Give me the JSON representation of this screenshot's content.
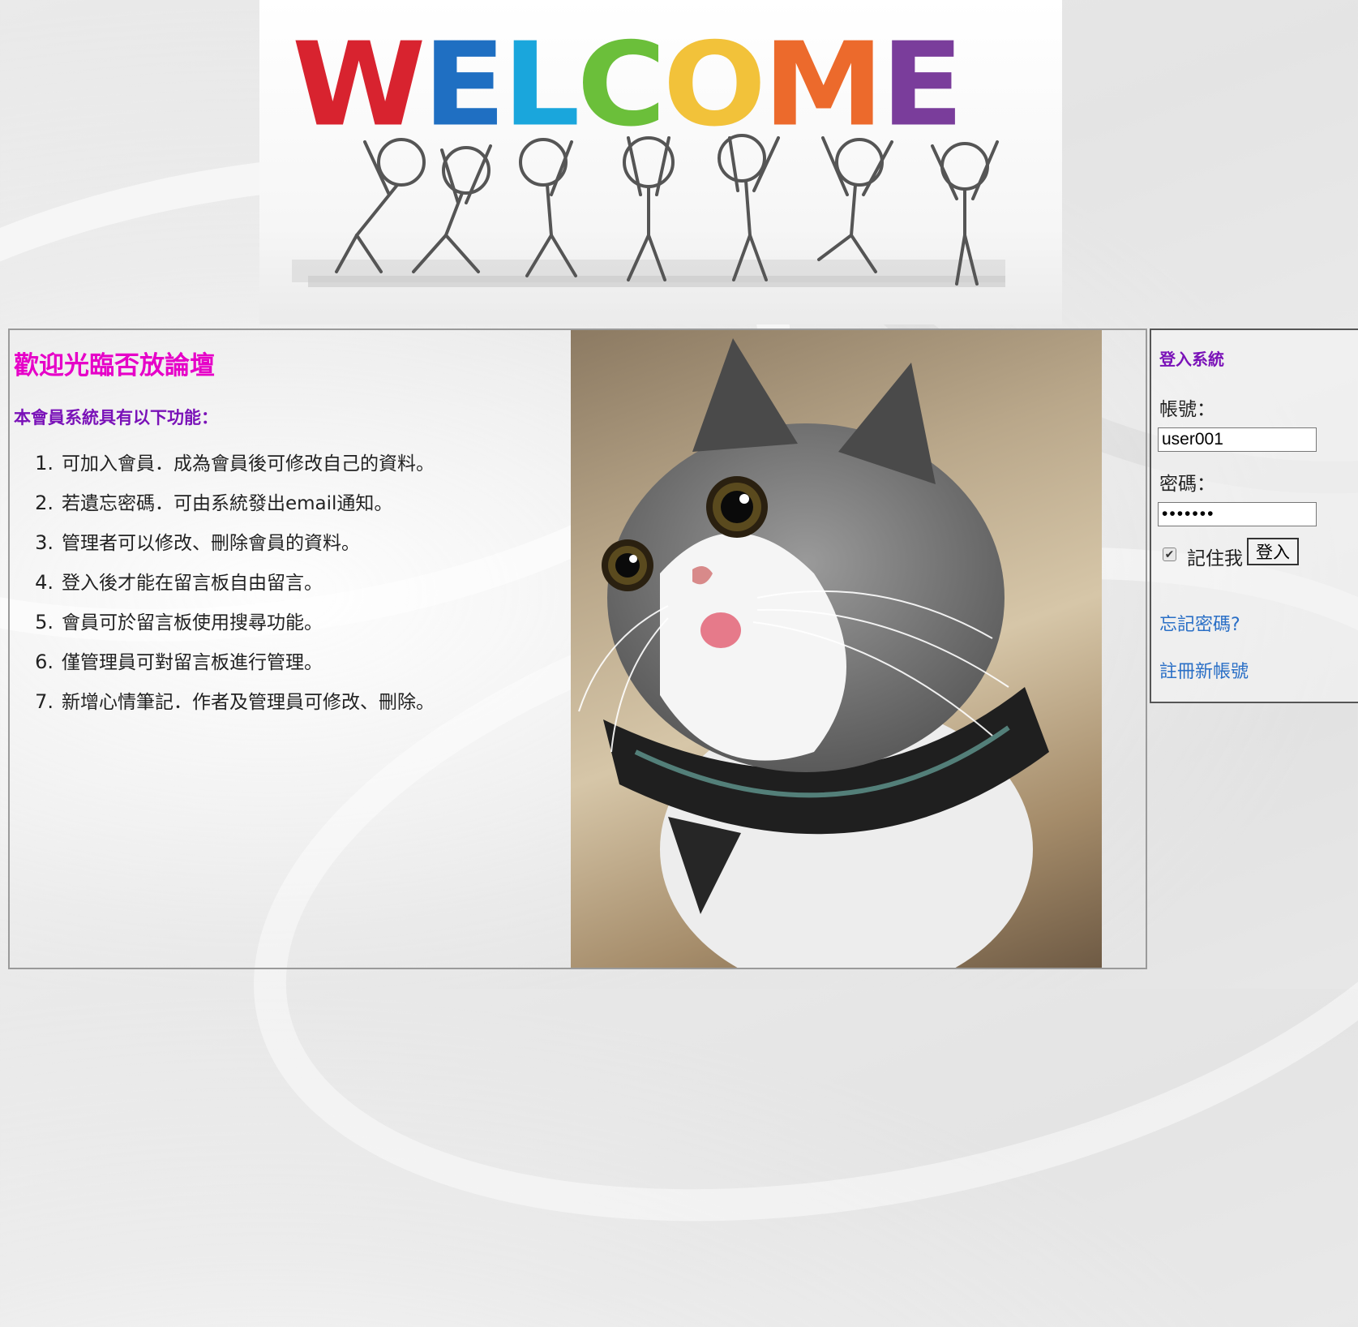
{
  "banner": {
    "letters": [
      {
        "char": "W",
        "color": "#d8232f"
      },
      {
        "char": "E",
        "color": "#1f6fc2"
      },
      {
        "char": "L",
        "color": "#1aa6dc"
      },
      {
        "char": "C",
        "color": "#6bbf3a"
      },
      {
        "char": "O",
        "color": "#f2c23a"
      },
      {
        "char": "M",
        "color": "#ec6a2c"
      },
      {
        "char": "E",
        "color": "#7a3d9b"
      }
    ]
  },
  "main": {
    "title": "歡迎光臨否放論壇",
    "features_heading": "本會員系統具有以下功能：",
    "features": [
      {
        "num": "1.",
        "text": "可加入會員．成為會員後可修改自己的資料。"
      },
      {
        "num": "2.",
        "text": "若遺忘密碼．可由系統發出email通知。"
      },
      {
        "num": "3.",
        "text": "管理者可以修改、刪除會員的資料。"
      },
      {
        "num": "4.",
        "text": "登入後才能在留言板自由留言。"
      },
      {
        "num": "5.",
        "text": "會員可於留言板使用搜尋功能。"
      },
      {
        "num": "6.",
        "text": "僅管理員可對留言板進行管理。"
      },
      {
        "num": "7.",
        "text": "新增心情筆記．作者及管理員可修改、刪除。"
      }
    ]
  },
  "login": {
    "title": "登入系統",
    "account_label": "帳號：",
    "account_value": "user001",
    "password_label": "密碼：",
    "password_value": "•••••••",
    "remember_label": "記住我",
    "remember_checked": true,
    "login_button": "登入",
    "forgot_link": "忘記密碼?",
    "register_link": "註冊新帳號"
  },
  "colors": {
    "title_magenta": "#e600c8",
    "heading_purple": "#7a12b8",
    "link_blue": "#2a6fc6"
  }
}
